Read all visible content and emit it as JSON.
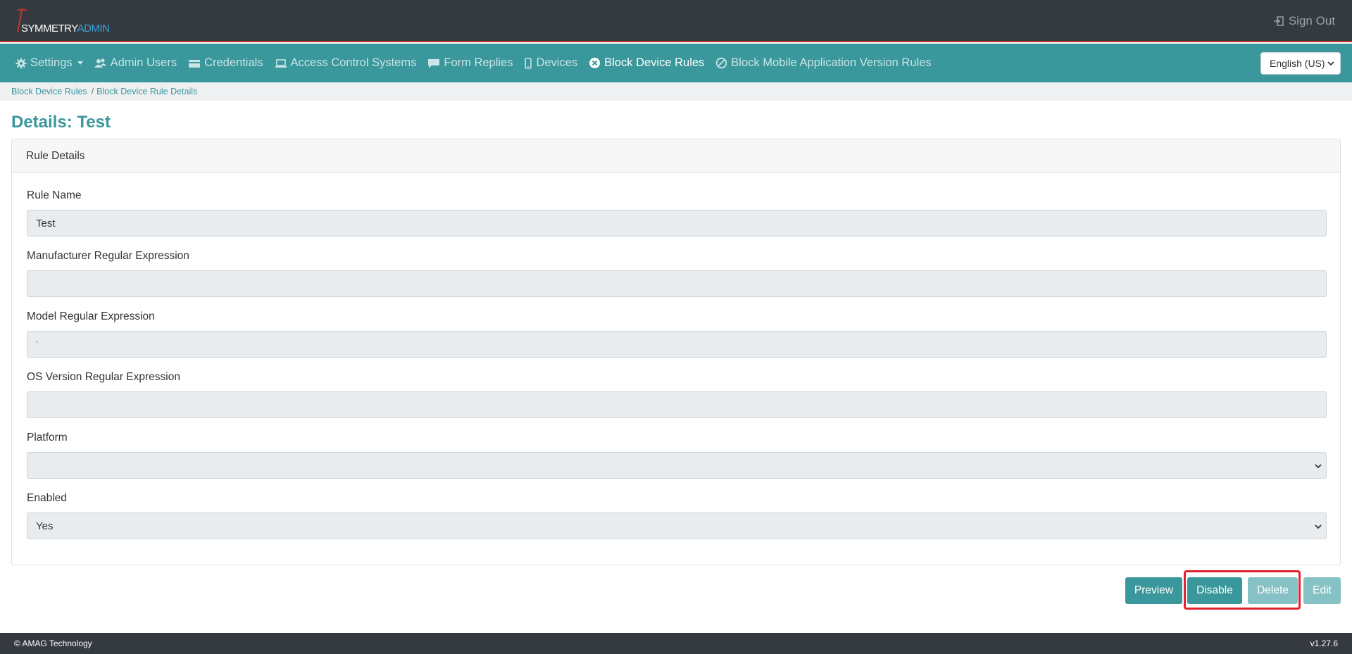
{
  "app": {
    "logo_symmetry": "SYMMETRY",
    "logo_admin": "ADMIN",
    "sign_out": "Sign Out"
  },
  "nav": {
    "items": [
      {
        "label": "Settings",
        "icon": "gear-icon"
      },
      {
        "label": "Admin Users",
        "icon": "users-icon"
      },
      {
        "label": "Credentials",
        "icon": "card-icon"
      },
      {
        "label": "Access Control Systems",
        "icon": "laptop-icon"
      },
      {
        "label": "Form Replies",
        "icon": "comment-icon"
      },
      {
        "label": "Devices",
        "icon": "mobile-icon"
      },
      {
        "label": "Block Device Rules",
        "icon": "circle-x-icon"
      },
      {
        "label": "Block Mobile Application Version Rules",
        "icon": "ban-icon"
      }
    ],
    "active": "Block Device Rules",
    "language": "English (US)"
  },
  "breadcrumb": {
    "items": [
      "Block Device Rules",
      "Block Device Rule Details"
    ],
    "separator": "/"
  },
  "page": {
    "title": "Details: Test"
  },
  "card": {
    "header": "Rule Details",
    "fields": [
      {
        "label": "Rule Name",
        "value": "Test",
        "type": "input"
      },
      {
        "label": "Manufacturer Regular Expression",
        "value": "",
        "type": "input"
      },
      {
        "label": "Model Regular Expression",
        "value": "'",
        "type": "input"
      },
      {
        "label": "OS Version Regular Expression",
        "value": "",
        "type": "input"
      },
      {
        "label": "Platform",
        "value": "",
        "type": "select"
      },
      {
        "label": "Enabled",
        "value": "Yes",
        "type": "select"
      }
    ]
  },
  "actions": {
    "preview": "Preview",
    "disable": "Disable",
    "delete": "Delete",
    "edit": "Edit"
  },
  "footer": {
    "copyright": "© AMAG Technology",
    "version": "v1.27.6"
  },
  "colors": {
    "topbar": "#343a40",
    "navbar": "#3a979b",
    "accent": "#3a979b",
    "highlight": "#e2232f"
  }
}
